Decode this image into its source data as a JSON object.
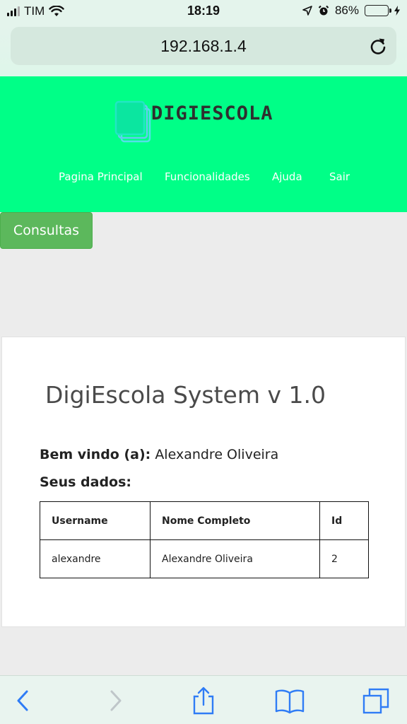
{
  "status_bar": {
    "carrier": "TIM",
    "time": "18:19",
    "battery": "86%",
    "battery_level": 0.86
  },
  "browser": {
    "url": "192.168.1.4"
  },
  "site": {
    "logo_text": "DIGIESCOLA",
    "nav": [
      "Pagina Principal",
      "Funcionalidades",
      "Ajuda",
      "Sair"
    ],
    "consultas_button": "Consultas"
  },
  "card": {
    "title": "DigiEscola System v 1.0",
    "welcome_label": "Bem vindo (a):",
    "welcome_name": "Alexandre Oliveira",
    "data_label": "Seus dados:",
    "table": {
      "headers": [
        "Username",
        "Nome Completo",
        "Id"
      ],
      "rows": [
        [
          "alexandre",
          "Alexandre Oliveira",
          "2"
        ]
      ]
    }
  },
  "colors": {
    "header_green": "#00ff87",
    "button_green": "#5cb85c",
    "ios_blue": "#2f7cf6"
  }
}
